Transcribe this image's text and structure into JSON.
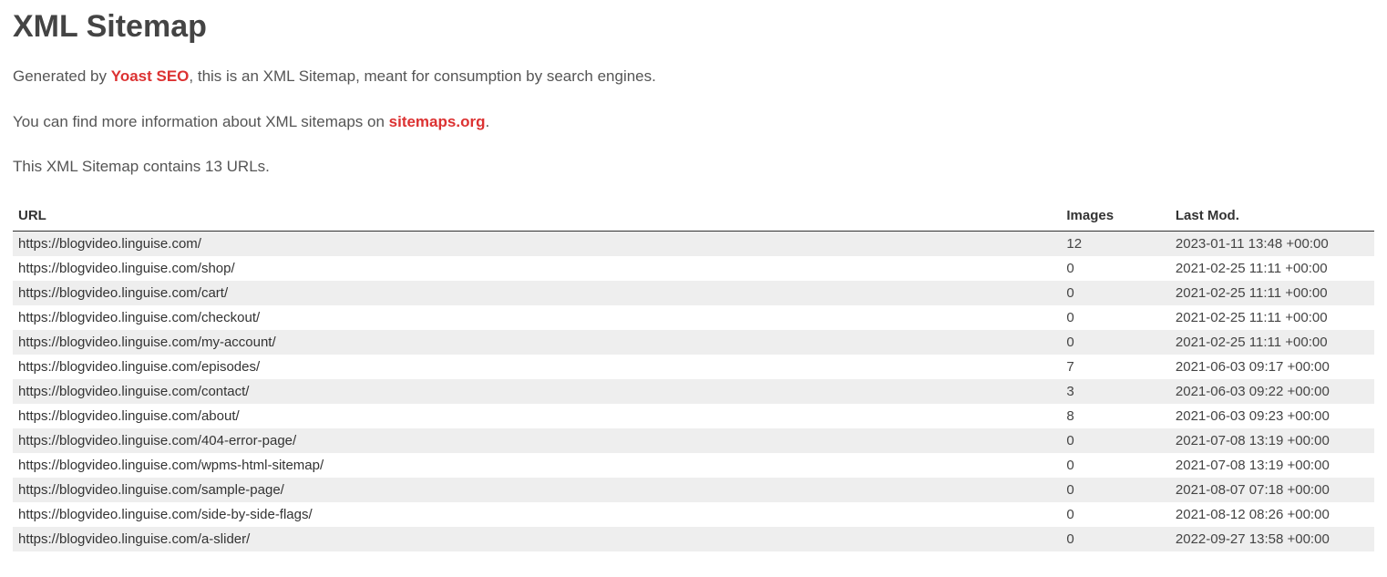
{
  "title": "XML Sitemap",
  "intro": {
    "generated_prefix": "Generated by ",
    "yoast_label": "Yoast SEO",
    "generated_suffix": ", this is an XML Sitemap, meant for consumption by search engines.",
    "info_prefix": "You can find more information about XML sitemaps on ",
    "sitemaps_label": "sitemaps.org",
    "info_suffix": ".",
    "count_text": "This XML Sitemap contains 13 URLs."
  },
  "table": {
    "headers": {
      "url": "URL",
      "images": "Images",
      "lastmod": "Last Mod."
    },
    "rows": [
      {
        "url": "https://blogvideo.linguise.com/",
        "images": "12",
        "lastmod": "2023-01-11 13:48 +00:00"
      },
      {
        "url": "https://blogvideo.linguise.com/shop/",
        "images": "0",
        "lastmod": "2021-02-25 11:11 +00:00"
      },
      {
        "url": "https://blogvideo.linguise.com/cart/",
        "images": "0",
        "lastmod": "2021-02-25 11:11 +00:00"
      },
      {
        "url": "https://blogvideo.linguise.com/checkout/",
        "images": "0",
        "lastmod": "2021-02-25 11:11 +00:00"
      },
      {
        "url": "https://blogvideo.linguise.com/my-account/",
        "images": "0",
        "lastmod": "2021-02-25 11:11 +00:00"
      },
      {
        "url": "https://blogvideo.linguise.com/episodes/",
        "images": "7",
        "lastmod": "2021-06-03 09:17 +00:00"
      },
      {
        "url": "https://blogvideo.linguise.com/contact/",
        "images": "3",
        "lastmod": "2021-06-03 09:22 +00:00"
      },
      {
        "url": "https://blogvideo.linguise.com/about/",
        "images": "8",
        "lastmod": "2021-06-03 09:23 +00:00"
      },
      {
        "url": "https://blogvideo.linguise.com/404-error-page/",
        "images": "0",
        "lastmod": "2021-07-08 13:19 +00:00"
      },
      {
        "url": "https://blogvideo.linguise.com/wpms-html-sitemap/",
        "images": "0",
        "lastmod": "2021-07-08 13:19 +00:00"
      },
      {
        "url": "https://blogvideo.linguise.com/sample-page/",
        "images": "0",
        "lastmod": "2021-08-07 07:18 +00:00"
      },
      {
        "url": "https://blogvideo.linguise.com/side-by-side-flags/",
        "images": "0",
        "lastmod": "2021-08-12 08:26 +00:00"
      },
      {
        "url": "https://blogvideo.linguise.com/a-slider/",
        "images": "0",
        "lastmod": "2022-09-27 13:58 +00:00"
      }
    ]
  }
}
